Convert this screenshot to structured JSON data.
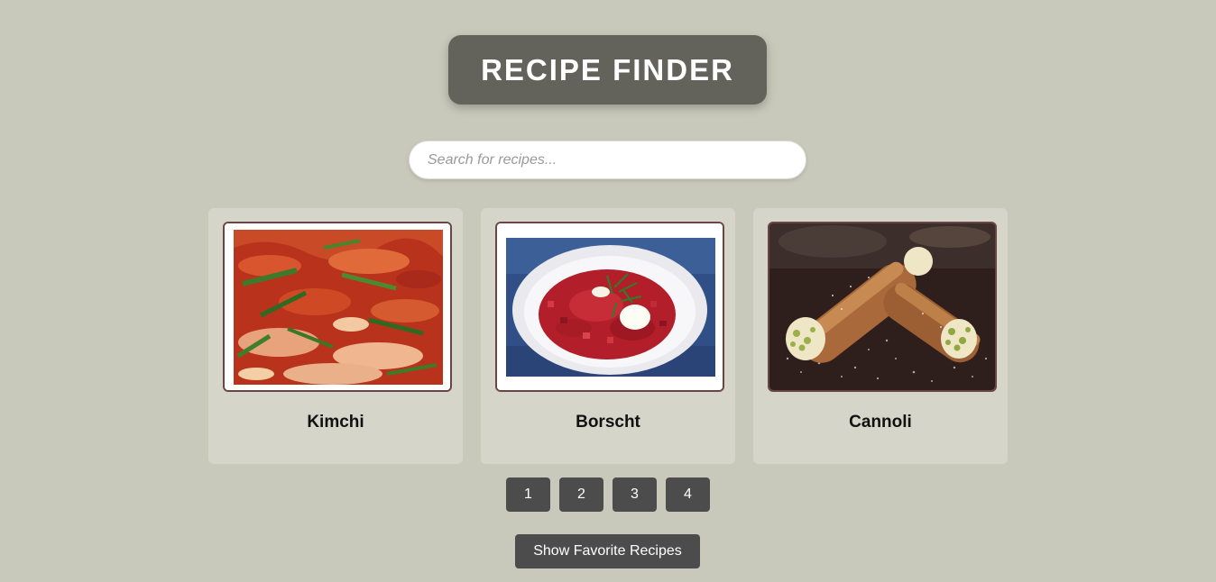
{
  "header": {
    "title": "RECIPE FINDER"
  },
  "search": {
    "placeholder": "Search for recipes..."
  },
  "recipes": [
    {
      "name": "Kimchi",
      "image": "kimchi-photo"
    },
    {
      "name": "Borscht",
      "image": "borscht-photo"
    },
    {
      "name": "Cannoli",
      "image": "cannoli-photo"
    }
  ],
  "pagination": {
    "pages": [
      "1",
      "2",
      "3",
      "4"
    ]
  },
  "actions": {
    "favorites_label": "Show Favorite Recipes"
  },
  "colors": {
    "background": "#c9c9bb",
    "header_bg": "#64635b",
    "card_bg": "#d5d5c9",
    "button_bg": "#4c4c4c",
    "image_border": "#6b4544"
  }
}
